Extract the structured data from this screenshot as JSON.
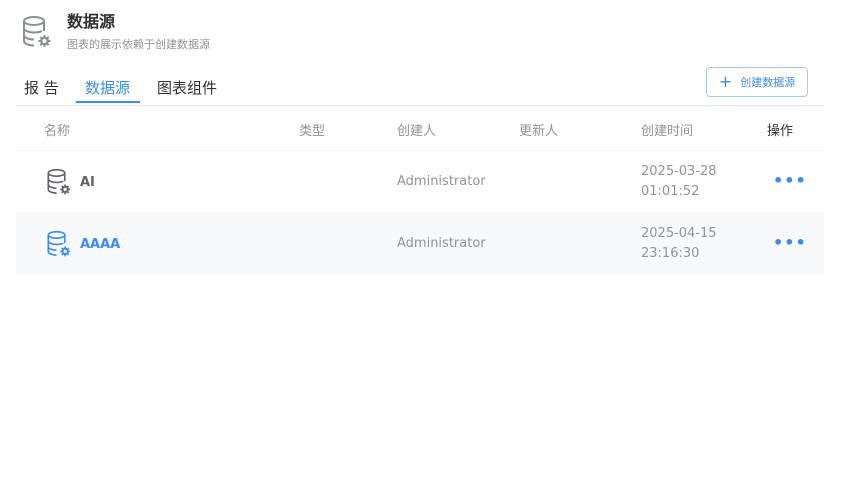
{
  "header": {
    "title": "数据源",
    "subtitle": "图表的展示依赖于创建数据源",
    "icon": "database-settings-icon"
  },
  "tabs": [
    {
      "label": "报 告",
      "active": false
    },
    {
      "label": "数据源",
      "active": true
    },
    {
      "label": "图表组件",
      "active": false
    }
  ],
  "toolbar": {
    "create_label": "创建数据源",
    "create_icon": "plus-icon"
  },
  "table": {
    "columns": [
      "名称",
      "类型",
      "创建人",
      "更新人",
      "创建时间",
      "操作"
    ],
    "rows": [
      {
        "name": "AI",
        "type": "",
        "creator": "Administrator",
        "updater": "",
        "created_date": "2025-03-28",
        "created_time": "01:01:52",
        "action": "•••"
      },
      {
        "name": "AAAA",
        "type": "",
        "creator": "Administrator",
        "updater": "",
        "created_date": "2025-04-15",
        "created_time": "23:16:30",
        "action": "•••"
      }
    ]
  },
  "colors": {
    "accent": "#3e8bf0",
    "muted_text": "#909399",
    "row_hover": "#f7f9fb"
  }
}
